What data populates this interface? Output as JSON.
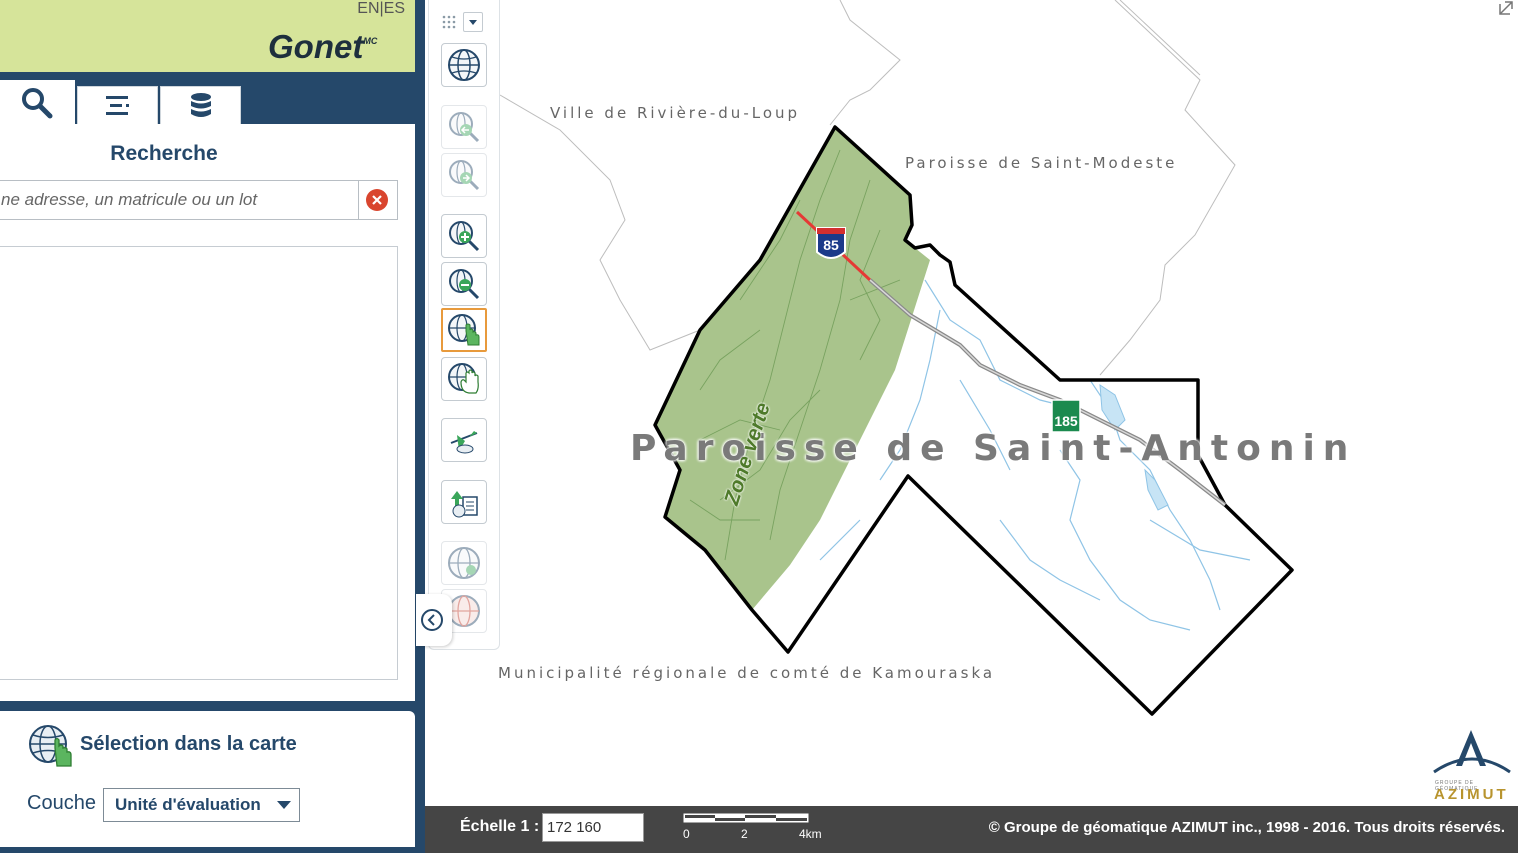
{
  "header": {
    "lang_en": "EN",
    "lang_sep": "|",
    "lang_es": "ES",
    "logo_text": "Gonet",
    "logo_sup": "MC"
  },
  "tabs": [
    {
      "icon": "search-icon"
    },
    {
      "icon": "list-icon"
    },
    {
      "icon": "database-icon"
    }
  ],
  "search": {
    "title": "Recherche",
    "placeholder": "ne adresse, un matricule ou un lot"
  },
  "selection": {
    "title": "Sélection dans la carte",
    "couche_label": "Couche",
    "couche_value": "Unité d'évaluation"
  },
  "toolbar": {
    "tools": [
      {
        "icon": "globe-full-extent-icon"
      },
      {
        "icon": "zoom-previous-icon"
      },
      {
        "icon": "zoom-next-icon"
      },
      {
        "icon": "zoom-in-icon"
      },
      {
        "icon": "zoom-out-icon"
      },
      {
        "icon": "select-hand-icon"
      },
      {
        "icon": "pan-hand-icon"
      },
      {
        "icon": "airplane-icon"
      },
      {
        "icon": "export-icon"
      },
      {
        "icon": "globe-disabled-icon"
      },
      {
        "icon": "globe-red-disabled-icon"
      }
    ]
  },
  "map": {
    "labels": {
      "riviere_du_loup": "Ville de Rivière-du-Loup",
      "saint_modeste": "Paroisse de Saint-Modeste",
      "saint_antonin": "Paroisse de Saint-Antonin",
      "kamouraska": "Municipalité régionale de comté de Kamouraska",
      "zone_verte": "Zone verte"
    },
    "shields": {
      "interstate": "85",
      "route": "185"
    },
    "colors": {
      "zone_verte": "#a9c48c",
      "boundary": "#000000",
      "water": "#9fd0ee",
      "highway": "#9b9b9b"
    }
  },
  "footer": {
    "scale_label": "Échelle 1 :",
    "scale_value": "172 160",
    "scalebar": [
      "0",
      "2",
      "4km"
    ],
    "copyright": "© Groupe de géomatique AZIMUT inc., 1998 - 2016. Tous droits réservés."
  },
  "branding": {
    "azimut": "AZIMUT",
    "azimut_sub": "GROUPE DE GÉOMATIQUE"
  }
}
